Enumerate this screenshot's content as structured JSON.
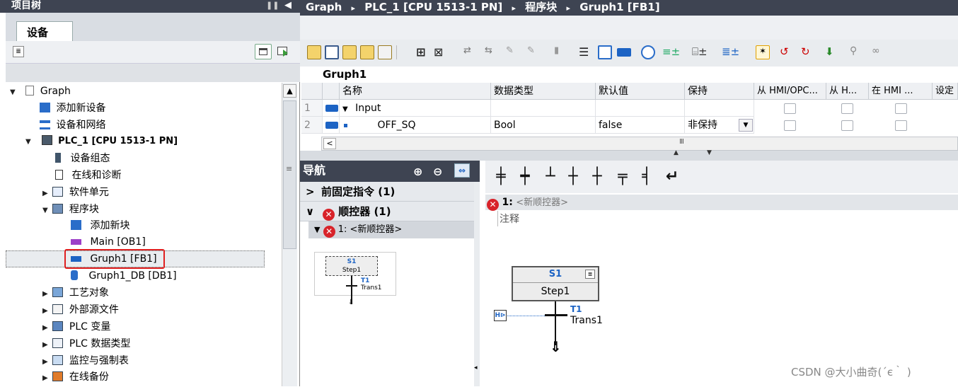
{
  "project_tree": {
    "title": "项目树",
    "tab_label": "设备",
    "items": [
      {
        "label": "Graph",
        "expander": "▼"
      },
      {
        "label": "添加新设备",
        "expander": ""
      },
      {
        "label": "设备和网络",
        "expander": ""
      },
      {
        "label": "PLC_1 [CPU 1513-1 PN]",
        "expander": "▼"
      },
      {
        "label": "设备组态",
        "expander": ""
      },
      {
        "label": "在线和诊断",
        "expander": ""
      },
      {
        "label": "软件单元",
        "expander": "▶"
      },
      {
        "label": "程序块",
        "expander": "▼"
      },
      {
        "label": "添加新块",
        "expander": ""
      },
      {
        "label": "Main [OB1]",
        "expander": ""
      },
      {
        "label": "Gruph1 [FB1]",
        "expander": ""
      },
      {
        "label": "Gruph1_DB [DB1]",
        "expander": ""
      },
      {
        "label": "工艺对象",
        "expander": "▶"
      },
      {
        "label": "外部源文件",
        "expander": "▶"
      },
      {
        "label": "PLC 变量",
        "expander": "▶"
      },
      {
        "label": "PLC 数据类型",
        "expander": "▶"
      },
      {
        "label": "监控与强制表",
        "expander": "▶"
      },
      {
        "label": "在线备份",
        "expander": "▶"
      }
    ]
  },
  "breadcrumb": {
    "items": [
      "Graph",
      "PLC_1 [CPU 1513-1 PN]",
      "程序块",
      "Gruph1 [FB1]"
    ],
    "separator": "▸"
  },
  "block_name": "Gruph1",
  "interface": {
    "columns": [
      "名称",
      "数据类型",
      "默认值",
      "保持",
      "从 HMI/OPC...",
      "从 H...",
      "在 HMI ...",
      "设定"
    ],
    "rows": [
      {
        "num": "1",
        "expander": "▼",
        "name": "Input",
        "type": "",
        "default": "",
        "retain": ""
      },
      {
        "num": "2",
        "expander": "",
        "name": "OFF_SQ",
        "type": "Bool",
        "default": "false",
        "retain": "非保持"
      }
    ],
    "scroll_glyph": "Ⅲ"
  },
  "navigation": {
    "title": "导航",
    "sections": [
      {
        "expander": ">",
        "label": "前固定指令 (1)"
      },
      {
        "expander": "∨",
        "label": "顺控器 (1)"
      }
    ],
    "sequencer_item": "1: <新顺控器>",
    "thumb_step_name": "S1",
    "thumb_step_label": "Step1",
    "thumb_trans_name": "T1",
    "thumb_trans_label": "Trans1"
  },
  "editor": {
    "sequencer_num": "1:",
    "sequencer_title": "<新顺控器>",
    "comment": "注释",
    "step_name": "S1",
    "step_label": "Step1",
    "trans_name": "T1",
    "trans_label": "Trans1",
    "step_icon": "step-detail-icon"
  },
  "watermark": "CSDN @大小曲奇(´є｀ )",
  "colors": {
    "title_bar": "#3e4452",
    "highlight_box": "#e02020",
    "error": "#d8232a",
    "accent_blue": "#1c63c4"
  }
}
